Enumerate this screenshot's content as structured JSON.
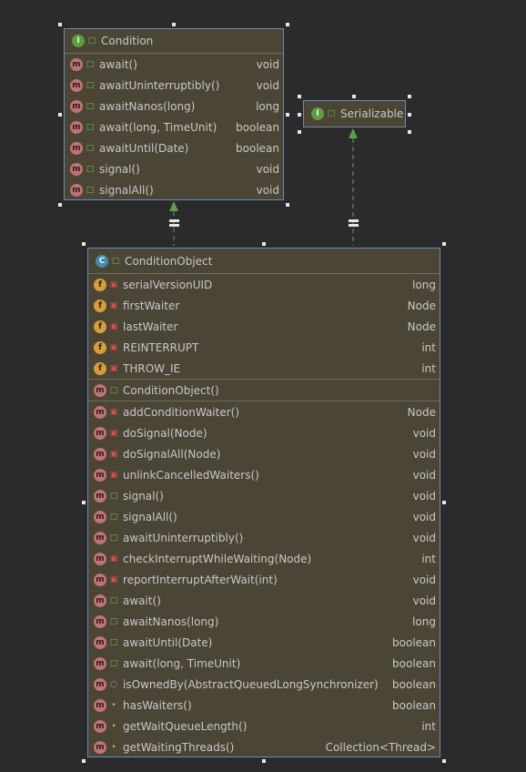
{
  "colors": {
    "background": "#2b2b2b",
    "box_fill": "#4a4534",
    "box_border": "#6a8bb8",
    "arrow": "#5fa04a"
  },
  "condition": {
    "title": "Condition",
    "icon": "interface-icon",
    "members": [
      {
        "icon": "m",
        "vis": "public",
        "name": "await()",
        "type": "void"
      },
      {
        "icon": "m",
        "vis": "public",
        "name": "awaitUninterruptibly()",
        "type": "void"
      },
      {
        "icon": "m",
        "vis": "public",
        "name": "awaitNanos(long)",
        "type": "long"
      },
      {
        "icon": "m",
        "vis": "public",
        "name": "await(long, TimeUnit)",
        "type": "boolean"
      },
      {
        "icon": "m",
        "vis": "public",
        "name": "awaitUntil(Date)",
        "type": "boolean"
      },
      {
        "icon": "m",
        "vis": "public",
        "name": "signal()",
        "type": "void"
      },
      {
        "icon": "m",
        "vis": "public",
        "name": "signalAll()",
        "type": "void"
      }
    ]
  },
  "serializable": {
    "title": "Serializable",
    "icon": "interface-icon"
  },
  "condition_object": {
    "title": "ConditionObject",
    "icon": "class-icon",
    "fields": [
      {
        "icon": "f",
        "vis": "private",
        "name": "serialVersionUID",
        "type": "long"
      },
      {
        "icon": "f",
        "vis": "private",
        "name": "firstWaiter",
        "type": "Node"
      },
      {
        "icon": "f",
        "vis": "private",
        "name": "lastWaiter",
        "type": "Node"
      },
      {
        "icon": "f",
        "vis": "private",
        "name": "REINTERRUPT",
        "type": "int"
      },
      {
        "icon": "f",
        "vis": "private",
        "name": "THROW_IE",
        "type": "int"
      }
    ],
    "constructors": [
      {
        "icon": "m",
        "vis": "public",
        "name": "ConditionObject()",
        "type": ""
      }
    ],
    "methods": [
      {
        "icon": "m",
        "vis": "private",
        "name": "addConditionWaiter()",
        "type": "Node"
      },
      {
        "icon": "m",
        "vis": "private",
        "name": "doSignal(Node)",
        "type": "void"
      },
      {
        "icon": "m",
        "vis": "private",
        "name": "doSignalAll(Node)",
        "type": "void"
      },
      {
        "icon": "m",
        "vis": "private",
        "name": "unlinkCancelledWaiters()",
        "type": "void"
      },
      {
        "icon": "m",
        "vis": "public",
        "name": "signal()",
        "type": "void"
      },
      {
        "icon": "m",
        "vis": "public",
        "name": "signalAll()",
        "type": "void"
      },
      {
        "icon": "m",
        "vis": "public",
        "name": "awaitUninterruptibly()",
        "type": "void"
      },
      {
        "icon": "m",
        "vis": "private",
        "name": "checkInterruptWhileWaiting(Node)",
        "type": "int"
      },
      {
        "icon": "m",
        "vis": "private",
        "name": "reportInterruptAfterWait(int)",
        "type": "void"
      },
      {
        "icon": "m",
        "vis": "public",
        "name": "await()",
        "type": "void"
      },
      {
        "icon": "m",
        "vis": "public",
        "name": "awaitNanos(long)",
        "type": "long"
      },
      {
        "icon": "m",
        "vis": "public",
        "name": "awaitUntil(Date)",
        "type": "boolean"
      },
      {
        "icon": "m",
        "vis": "public",
        "name": "await(long, TimeUnit)",
        "type": "boolean"
      },
      {
        "icon": "m",
        "vis": "package",
        "name": "isOwnedBy(AbstractQueuedLongSynchronizer)",
        "type": "boolean"
      },
      {
        "icon": "m",
        "vis": "protected",
        "name": "hasWaiters()",
        "type": "boolean"
      },
      {
        "icon": "m",
        "vis": "protected",
        "name": "getWaitQueueLength()",
        "type": "int"
      },
      {
        "icon": "m",
        "vis": "protected",
        "name": "getWaitingThreads()",
        "type": "Collection<Thread>"
      }
    ]
  }
}
